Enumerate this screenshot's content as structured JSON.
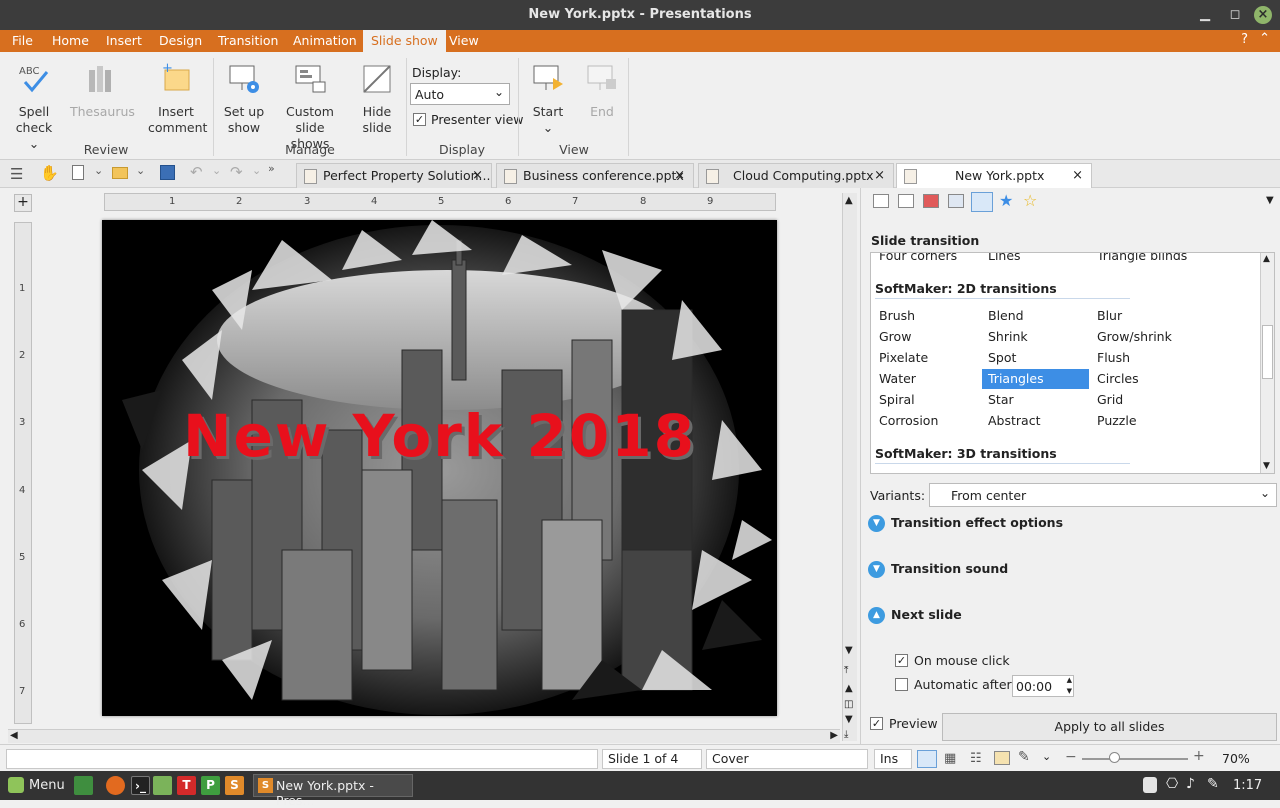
{
  "window": {
    "title": "New York.pptx - Presentations",
    "help_icon": "?"
  },
  "menu": [
    "File",
    "Home",
    "Insert",
    "Design",
    "Transition",
    "Animation",
    "Slide show",
    "View"
  ],
  "ribbon": {
    "review": {
      "label": "Review",
      "spell": "Spell",
      "spell2": "check",
      "thesaurus": "Thesaurus",
      "insert": "Insert",
      "insert2": "comment"
    },
    "manage": {
      "label": "Manage",
      "setup": "Set up",
      "setup2": "show",
      "custom": "Custom",
      "custom2": "slide shows",
      "hide": "Hide",
      "hide2": "slide"
    },
    "display": {
      "label": "Display",
      "display_label": "Display:",
      "display_value": "Auto",
      "presenter": "Presenter view"
    },
    "view": {
      "label": "View",
      "start": "Start",
      "end": "End"
    }
  },
  "tabs": [
    {
      "label": "Perfect Property Solution..."
    },
    {
      "label": "Business conference.pptx"
    },
    {
      "label": "Cloud Computing.pptx"
    },
    {
      "label": "New York.pptx"
    }
  ],
  "slide": {
    "title": "New York 2018"
  },
  "ruler": {
    "h": [
      "1",
      "2",
      "3",
      "4",
      "5",
      "6",
      "7",
      "8",
      "9"
    ],
    "v": [
      "1",
      "2",
      "3",
      "4",
      "5",
      "6",
      "7"
    ]
  },
  "panel": {
    "section_title": "Slide transition",
    "top_row": [
      "Four corners",
      "Lines",
      "Triangle blinds"
    ],
    "sec2d": "SoftMaker: 2D transitions",
    "items2d": [
      [
        "Brush",
        "Blend",
        "Blur"
      ],
      [
        "Grow",
        "Shrink",
        "Grow/shrink"
      ],
      [
        "Pixelate",
        "Spot",
        "Flush"
      ],
      [
        "Water",
        "Triangles",
        "Circles"
      ],
      [
        "Spiral",
        "Star",
        "Grid"
      ],
      [
        "Corrosion",
        "Abstract",
        "Puzzle"
      ]
    ],
    "sec3d": "SoftMaker: 3D transitions",
    "variants_label": "Variants:",
    "variants_value": "From center",
    "effect_options": "Transition effect options",
    "sound": "Transition sound",
    "next_slide": "Next slide",
    "on_click": "On mouse click",
    "auto_after": "Automatic after:",
    "auto_time": "00:00",
    "preview": "Preview",
    "apply_all": "Apply to all slides"
  },
  "status": {
    "slide": "Slide 1 of 4",
    "layout": "Cover",
    "mode": "Ins",
    "zoom": "70%"
  },
  "taskbar": {
    "menu": "Menu",
    "app_label": "New York.pptx - Pres...",
    "time": "1:17"
  },
  "colors": {
    "accent": "#d76f1f",
    "selection": "#3d8ee5",
    "slide_title": "#e8101c"
  }
}
